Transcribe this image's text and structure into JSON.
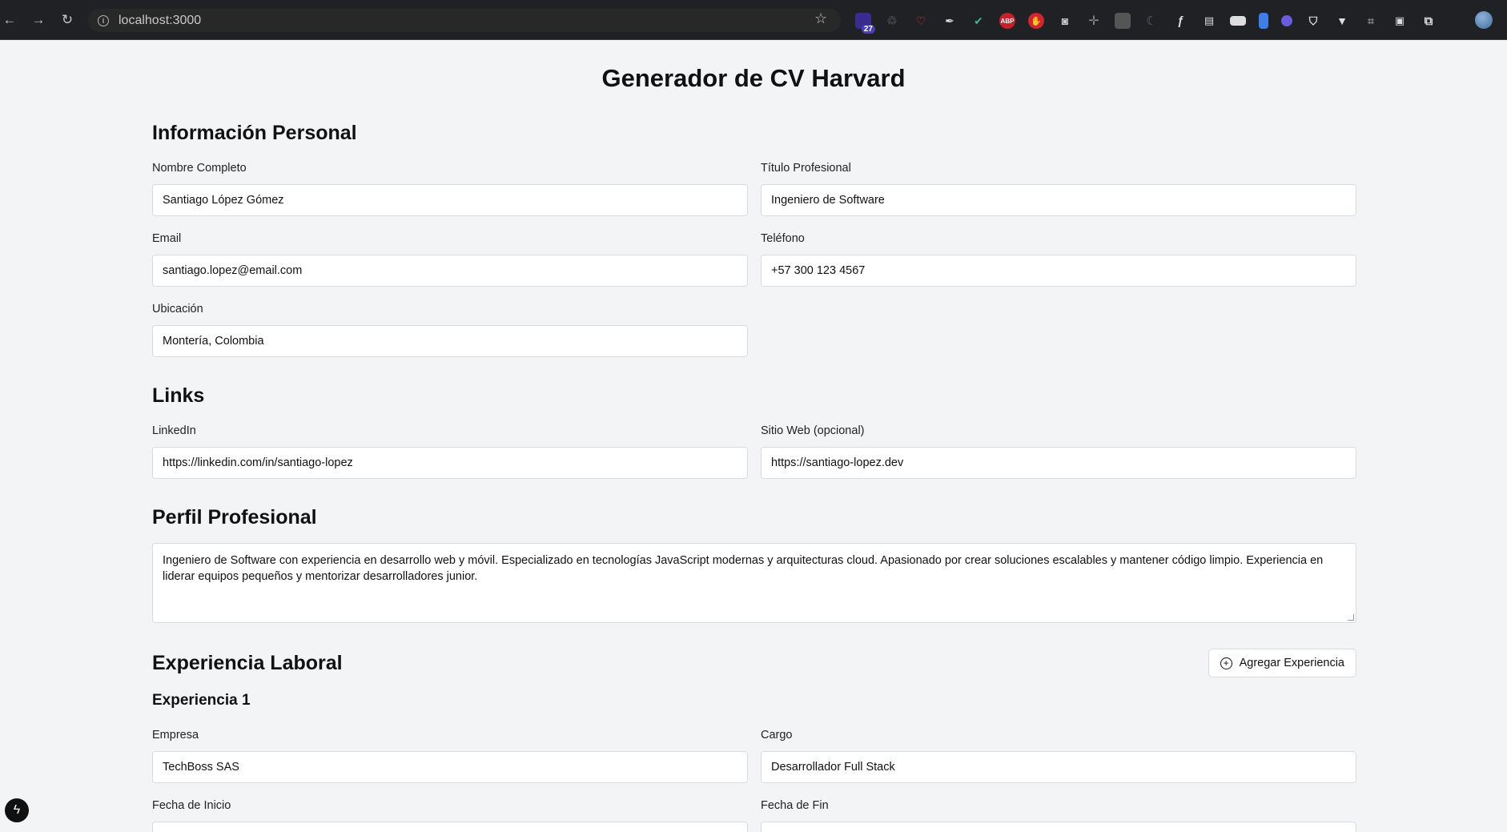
{
  "browser": {
    "url": "localhost:3000",
    "extensions_badge": "27",
    "abp_label": "ABP"
  },
  "page": {
    "title": "Generador de CV Harvard"
  },
  "personal": {
    "heading": "Información Personal",
    "name_label": "Nombre Completo",
    "name_value": "Santiago López Gómez",
    "title_label": "Título Profesional",
    "title_value": "Ingeniero de Software",
    "email_label": "Email",
    "email_value": "santiago.lopez@email.com",
    "phone_label": "Teléfono",
    "phone_value": "+57 300 123 4567",
    "location_label": "Ubicación",
    "location_value": "Montería, Colombia"
  },
  "links": {
    "heading": "Links",
    "linkedin_label": "LinkedIn",
    "linkedin_value": "https://linkedin.com/in/santiago-lopez",
    "website_label": "Sitio Web (opcional)",
    "website_value": "https://santiago-lopez.dev"
  },
  "profile": {
    "heading": "Perfil Profesional",
    "text": "Ingeniero de Software con experiencia en desarrollo web y móvil. Especializado en tecnologías JavaScript modernas y arquitecturas cloud. Apasionado por crear soluciones escalables y mantener código limpio. Experiencia en liderar equipos pequeños y mentorizar desarrolladores junior."
  },
  "experience": {
    "heading": "Experiencia Laboral",
    "add_button": "Agregar Experiencia",
    "item_title": "Experiencia 1",
    "company_label": "Empresa",
    "company_value": "TechBoss SAS",
    "role_label": "Cargo",
    "role_value": "Desarrollador Full Stack",
    "start_label": "Fecha de Inicio",
    "end_label": "Fecha de Fin"
  }
}
